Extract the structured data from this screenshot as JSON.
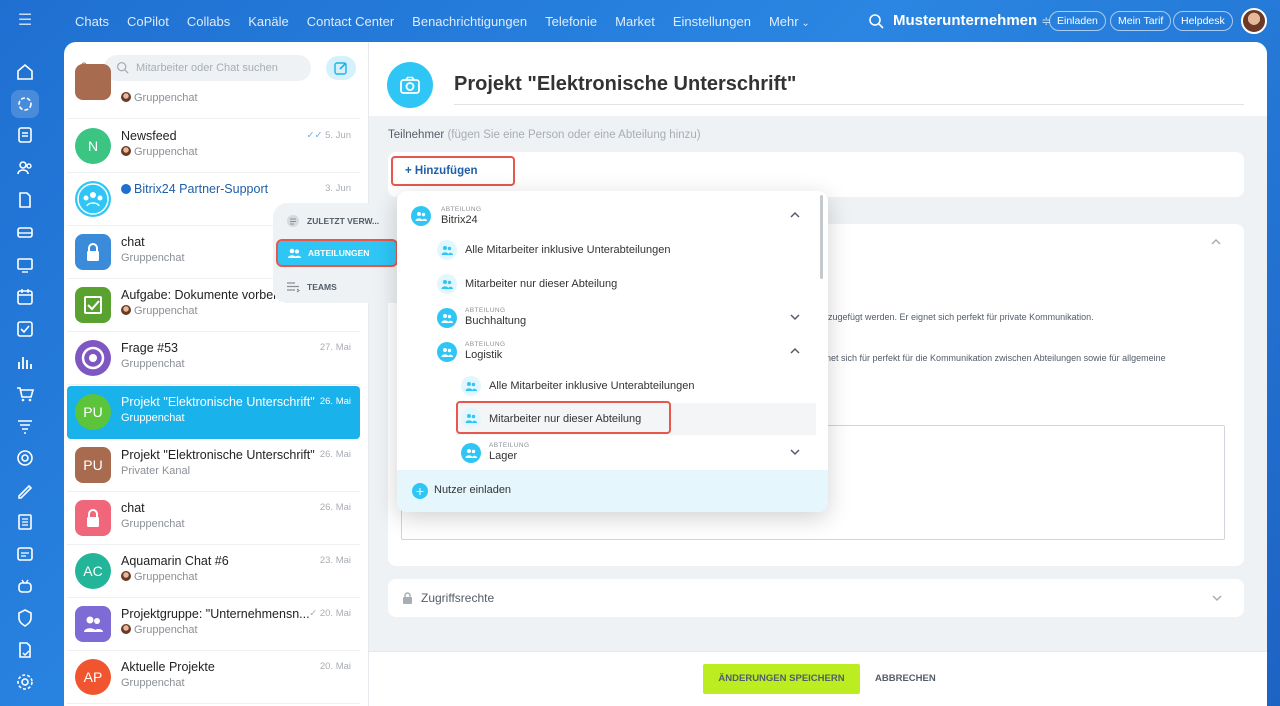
{
  "topnav": {
    "items": [
      "Chats",
      "CoPilot",
      "Collabs",
      "Kanäle",
      "Contact Center",
      "Benachrichtigungen",
      "Telefonie",
      "Market",
      "Einstellungen",
      "Mehr"
    ],
    "company": "Musterunternehmen",
    "buttons": [
      "Einladen",
      "Mein Tarif",
      "Helpdesk"
    ]
  },
  "chatlist": {
    "search_placeholder": "Mitarbeiter oder Chat suchen",
    "chats": [
      {
        "name": "",
        "sub": "Gruppenchat",
        "date": ""
      },
      {
        "name": "Newsfeed",
        "sub": "Gruppenchat",
        "date": "5. Jun",
        "avatar": "N"
      },
      {
        "name": "Bitrix24 Partner-Support",
        "sub": "",
        "date": "3. Jun"
      },
      {
        "name": "chat",
        "sub": "Gruppenchat",
        "date": ""
      },
      {
        "name": "Aufgabe: Dokumente vorbere...",
        "sub": "Gruppenchat",
        "date": ""
      },
      {
        "name": "Frage #53",
        "sub": "Gruppenchat",
        "date": "27. Mai"
      },
      {
        "name": "Projekt \"Elektronische Unterschrift\"",
        "sub": "Gruppenchat",
        "date": "26. Mai",
        "avatar": "PU"
      },
      {
        "name": "Projekt \"Elektronische Unterschrift\"",
        "sub": "Privater Kanal",
        "date": "26. Mai",
        "avatar": "PU"
      },
      {
        "name": "chat",
        "sub": "Gruppenchat",
        "date": "26. Mai"
      },
      {
        "name": "Aquamarin Chat #6",
        "sub": "Gruppenchat",
        "date": "23. Mai",
        "avatar": "AC"
      },
      {
        "name": "Projektgruppe: \"Unternehmensn...",
        "sub": "Gruppenchat",
        "date": "20. Mai"
      },
      {
        "name": "Aktuelle Projekte",
        "sub": "Gruppenchat",
        "date": "20. Mai",
        "avatar": "AP"
      }
    ]
  },
  "main": {
    "title": "Projekt \"Elektronische Unterschrift\"",
    "participants_label": "Teilnehmer",
    "participants_hint": "(fügen Sie eine Person oder eine Abteilung hinzu)",
    "add_button": "+ Hinzufügen",
    "text1": "inzugefügt werden. Er eignet sich perfekt für private Kommunikation.",
    "text2": "gnet sich für perfekt für die Kommunikation zwischen Abteilungen sowie für allgemeine",
    "access_label": "Zugriffsrechte",
    "save_button": "ÄNDERUNGEN SPEICHERN",
    "cancel_button": "ABBRECHEN"
  },
  "selector": {
    "tabs": [
      "ZULETZT VERW...",
      "ABTEILUNGEN",
      "TEAMS"
    ],
    "caption": "ABTEILUNG",
    "rows": {
      "bitrix": "Bitrix24",
      "all1": "Alle Mitarbeiter inklusive Unterabteilungen",
      "only1": "Mitarbeiter nur dieser Abteilung",
      "buch": "Buchhaltung",
      "logistik": "Logistik",
      "all2": "Alle Mitarbeiter inklusive Unterabteilungen",
      "only2": "Mitarbeiter nur dieser Abteilung",
      "lager": "Lager"
    },
    "invite": "Nutzer einladen"
  },
  "colors": {
    "accent": "#2fc6f6",
    "highlight": "#e8574b",
    "save": "#bbed21"
  }
}
